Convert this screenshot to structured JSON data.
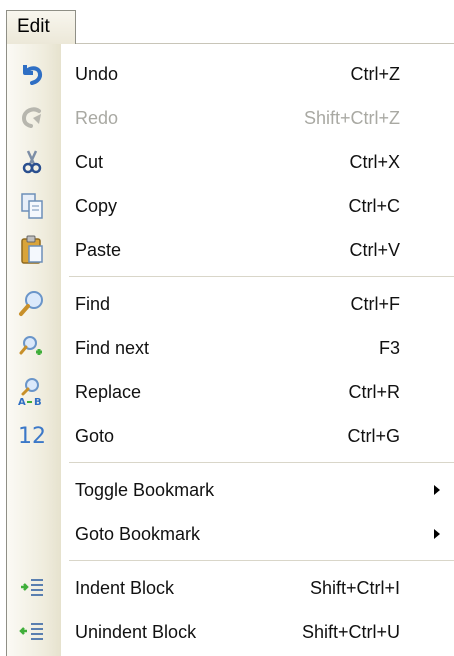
{
  "menu_title": "Edit",
  "colors": {
    "undo_icon": "#2f6fc4",
    "disabled_text": "#a9a9a3",
    "accent_green": "#3fae3a",
    "goto_icon": "#3b78c8"
  },
  "items": [
    {
      "label": "Undo",
      "shortcut": "Ctrl+Z",
      "icon": "undo-icon",
      "enabled": true
    },
    {
      "label": "Redo",
      "shortcut": "Shift+Ctrl+Z",
      "icon": "redo-icon",
      "enabled": false
    },
    {
      "label": "Cut",
      "shortcut": "Ctrl+X",
      "icon": "scissors-icon",
      "enabled": true
    },
    {
      "label": "Copy",
      "shortcut": "Ctrl+C",
      "icon": "copy-icon",
      "enabled": true
    },
    {
      "label": "Paste",
      "shortcut": "Ctrl+V",
      "icon": "paste-icon",
      "enabled": true
    },
    {
      "label": "Find",
      "shortcut": "Ctrl+F",
      "icon": "find-icon",
      "enabled": true
    },
    {
      "label": "Find next",
      "shortcut": "F3",
      "icon": "find-next-icon",
      "enabled": true
    },
    {
      "label": "Replace",
      "shortcut": "Ctrl+R",
      "icon": "replace-icon",
      "enabled": true
    },
    {
      "label": "Goto",
      "shortcut": "Ctrl+G",
      "icon": "goto-icon",
      "icon_text": "12",
      "enabled": true
    },
    {
      "label": "Toggle Bookmark",
      "shortcut": "",
      "icon": "",
      "submenu": true,
      "enabled": true
    },
    {
      "label": "Goto Bookmark",
      "shortcut": "",
      "icon": "",
      "submenu": true,
      "enabled": true
    },
    {
      "label": "Indent Block",
      "shortcut": "Shift+Ctrl+I",
      "icon": "indent-icon",
      "enabled": true
    },
    {
      "label": "Unindent Block",
      "shortcut": "Shift+Ctrl+U",
      "icon": "unindent-icon",
      "enabled": true
    }
  ]
}
